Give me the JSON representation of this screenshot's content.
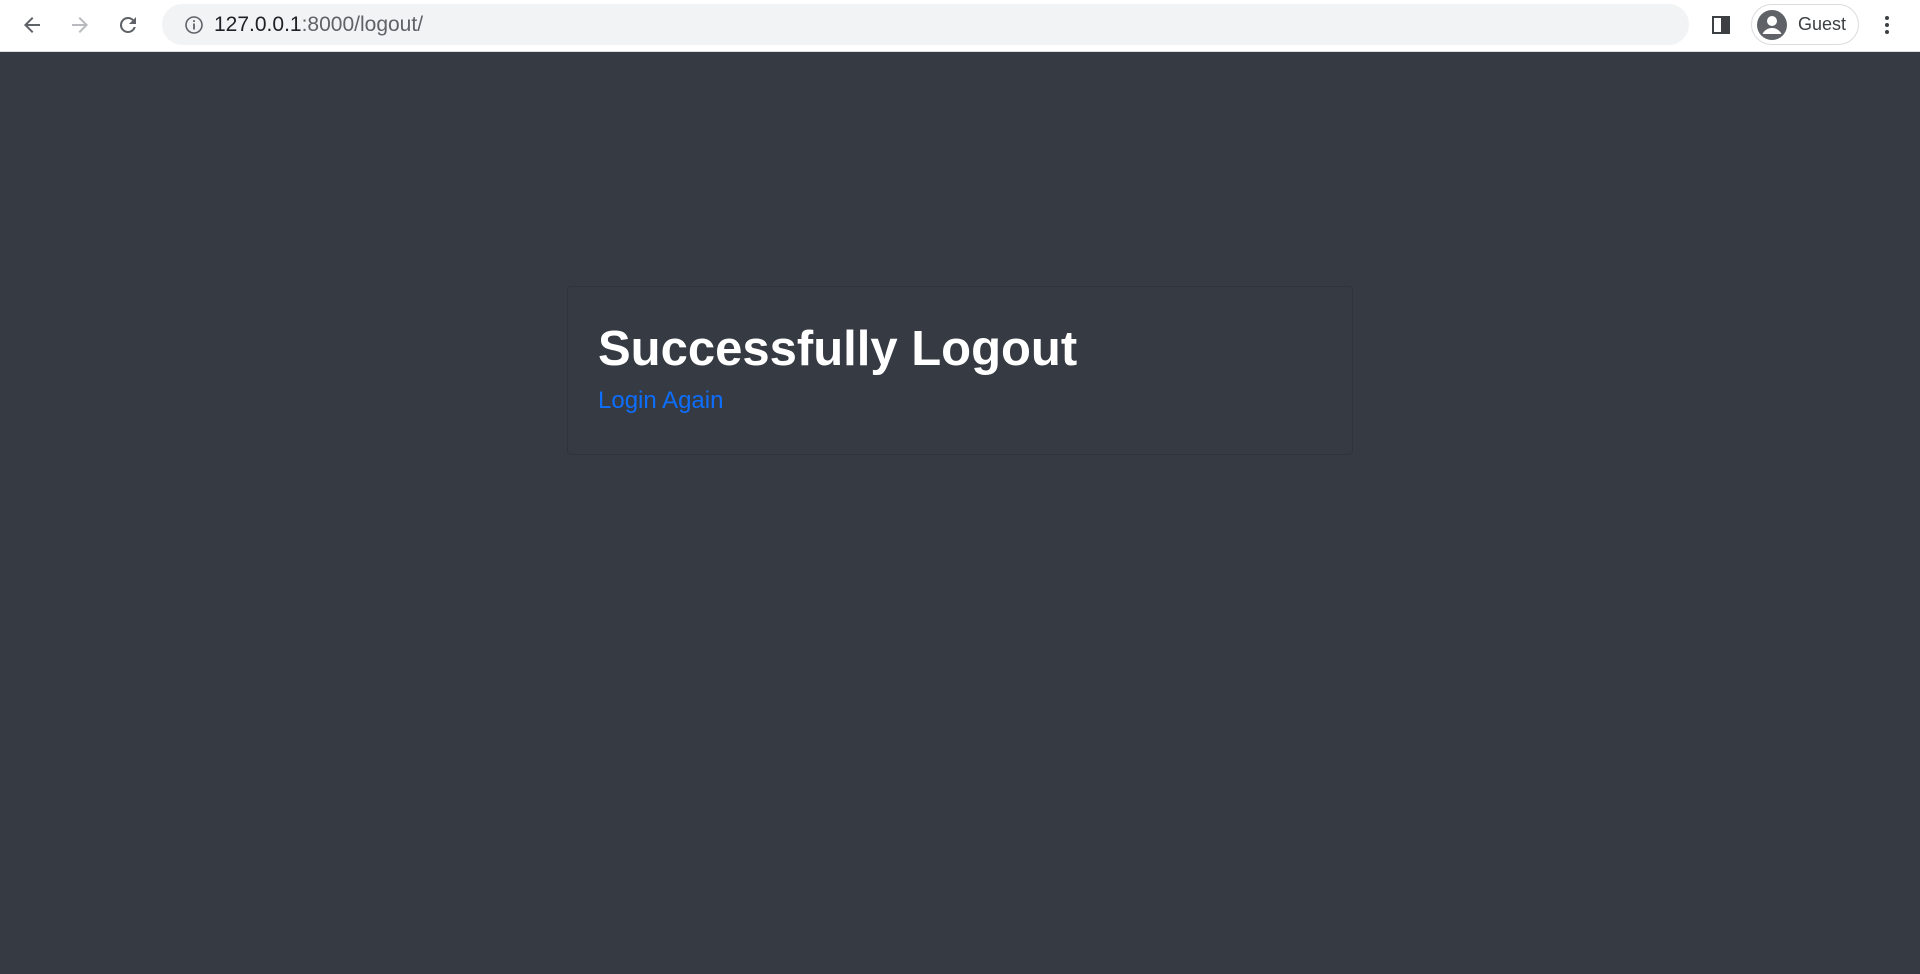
{
  "browser": {
    "url_host": "127.0.0.1",
    "url_path": ":8000/logout/",
    "profile_label": "Guest"
  },
  "page": {
    "title": "Successfully Logout",
    "link_label": "Login Again",
    "link_color": "#0d6efd",
    "background_color": "#363a42"
  }
}
